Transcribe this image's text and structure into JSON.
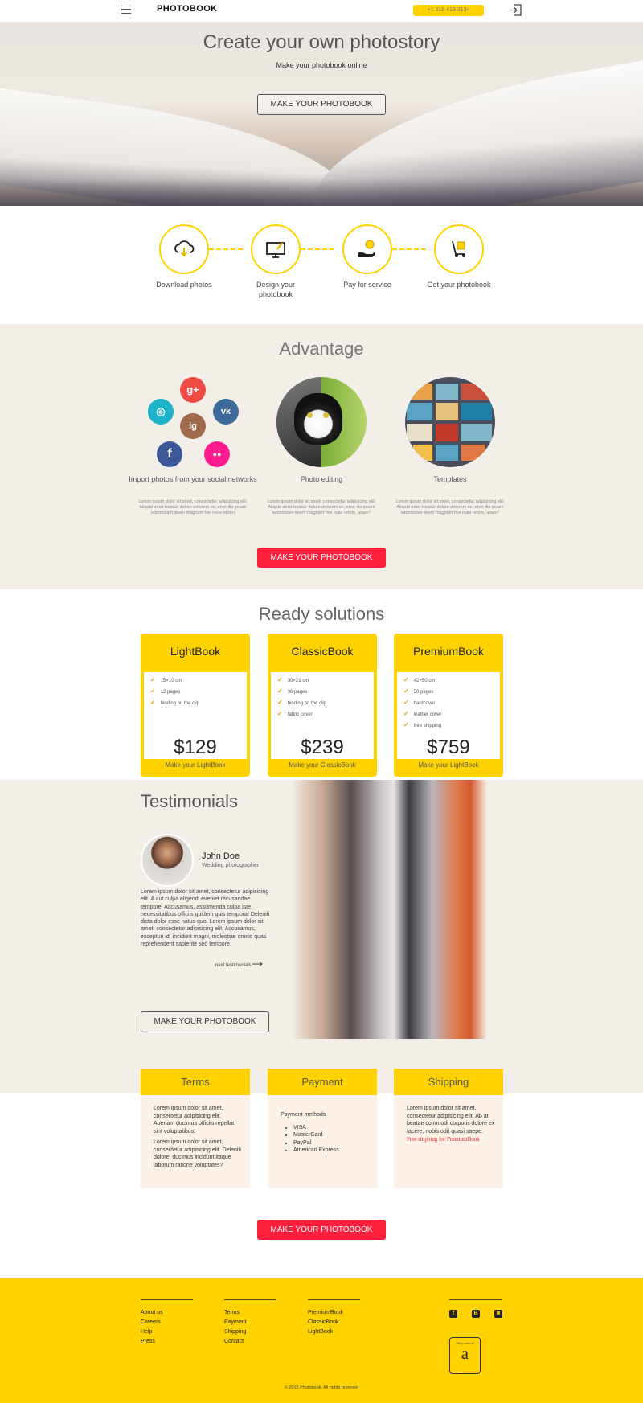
{
  "header": {
    "logo": "PHOTOBOOK",
    "phone": "+1 215 413 2134"
  },
  "hero": {
    "title": "Create your own photostory",
    "subtitle": "Make your photobook online",
    "button": "MAKE YOUR PHOTOBOOK"
  },
  "steps": [
    {
      "label": "Download photos",
      "icon": "cloud-download-icon"
    },
    {
      "label": "Design your photobook",
      "icon": "monitor-design-icon"
    },
    {
      "label": "Pay for service",
      "icon": "hand-coin-icon"
    },
    {
      "label": "Get your photobook",
      "icon": "hand-truck-icon"
    }
  ],
  "advantage": {
    "title": "Advantage",
    "items": [
      {
        "label": "Import photos from your social networks",
        "text": "Lorem ipsum dolor sit amet, consectetur adipisicing elit. Aliquid amet beatae dolore dolorem ex, error illo ipsam laboriosam libero magnam nisi nulla rerum"
      },
      {
        "label": "Photo editing",
        "text": "Lorem ipsum dolor sit amet, consectetur adipisicing elit. Aliquid amet beatae dolore dolorem ex, error illo ipsam laboriosam libero magnam nisi nulla rerum, ullam?"
      },
      {
        "label": "Templates",
        "text": "Lorem ipsum dolor sit amet, consectetur adipisicing elit. Aliquid amet beatae dolore dolorem ex, error illo ipsam laboriosam libero magnam nisi nulla rerum, ullam?"
      }
    ],
    "social": {
      "google": "g+",
      "vk": "vk",
      "instagram": "ig",
      "facebook": "f",
      "flickr": "●●",
      "aperture": "◎"
    },
    "button": "MAKE YOUR PHOTOBOOK"
  },
  "ready": {
    "title": "Ready solutions",
    "cards": [
      {
        "title": "LightBook",
        "features": [
          "15×10 cm",
          "12 pages",
          "binding on the clip"
        ],
        "price": "$129",
        "link": "Make your LightBook"
      },
      {
        "title": "ClassicBook",
        "features": [
          "30×21 cm",
          "36 pages",
          "binding on the clip",
          "fabric cover"
        ],
        "price": "$239",
        "link": "Make your ClassicBook"
      },
      {
        "title": "PremiumBook",
        "features": [
          "42×50 cm",
          "50 pages",
          "hardcover",
          "leather cover",
          "free shipping"
        ],
        "price": "$759",
        "link": "Make your LightBook"
      }
    ],
    "check": "✓"
  },
  "testimonials": {
    "title": "Testimonials",
    "name": "John Doe",
    "role": "Wedding photographer",
    "text": "Lorem ipsum dolor sit amet, consectetur adipisicing elit. A aut culpa eligendi eveniet recusandae tempore! Accusamus, assumenda culpa iste necessitatibus officiis quidem quis tempora! Deleniti dicta dolor esse natus quo. Lorem ipsum dolor sit amet, consectetur adipisicing elit. Accusamus, excepturi id, incidunt magni, molestiae omnis quas reprehenderit sapiente sed tempore.",
    "next": "next testimonials",
    "button": "MAKE YOUR PHOTOBOOK"
  },
  "info": {
    "terms": {
      "title": "Terms",
      "p1": "Lorem ipsum dolor sit amet, consectetur adipisicing elit. Aperiam ducimus officiis repellat sint voluptatibus!",
      "p2": "Lorem ipsum dolor sit amet, consectetur adipisicing elit. Deleniti dolore, ducimus incidunt itaque laborum ratione voluptates?"
    },
    "payment": {
      "title": "Payment",
      "heading": "Payment methods",
      "methods": [
        "VISA",
        "MasterCard",
        "PayPal",
        "American Express"
      ]
    },
    "shipping": {
      "title": "Shipping",
      "text": "Lorem ipsum dolor sit amet, consectetur adipisicing elit. Ab at beatae commodi corporis dolore ex facere, nobis odit quasi saepe.",
      "free": "Free shipping for PremiumBook"
    }
  },
  "cta": {
    "button": "MAKE YOUR PHOTOBOOK"
  },
  "footer": {
    "col1": [
      "About us",
      "Careers",
      "Help",
      "Press"
    ],
    "col2": [
      "Terms",
      "Payment",
      "Shipping",
      "Contact"
    ],
    "col3": [
      "PremiumBook",
      "ClassicBook",
      "LightBook"
    ],
    "social": {
      "facebook": "f",
      "blogger": "B",
      "instagram": "◙"
    },
    "amazon_caption": "Shop now at",
    "amazon_letter": "a",
    "copyright": "© 2015 Photobook. All rights reserved"
  },
  "colors": {
    "accent": "#ffd200",
    "cta": "#ff1e3c",
    "section_bg": "#f3efe8"
  }
}
